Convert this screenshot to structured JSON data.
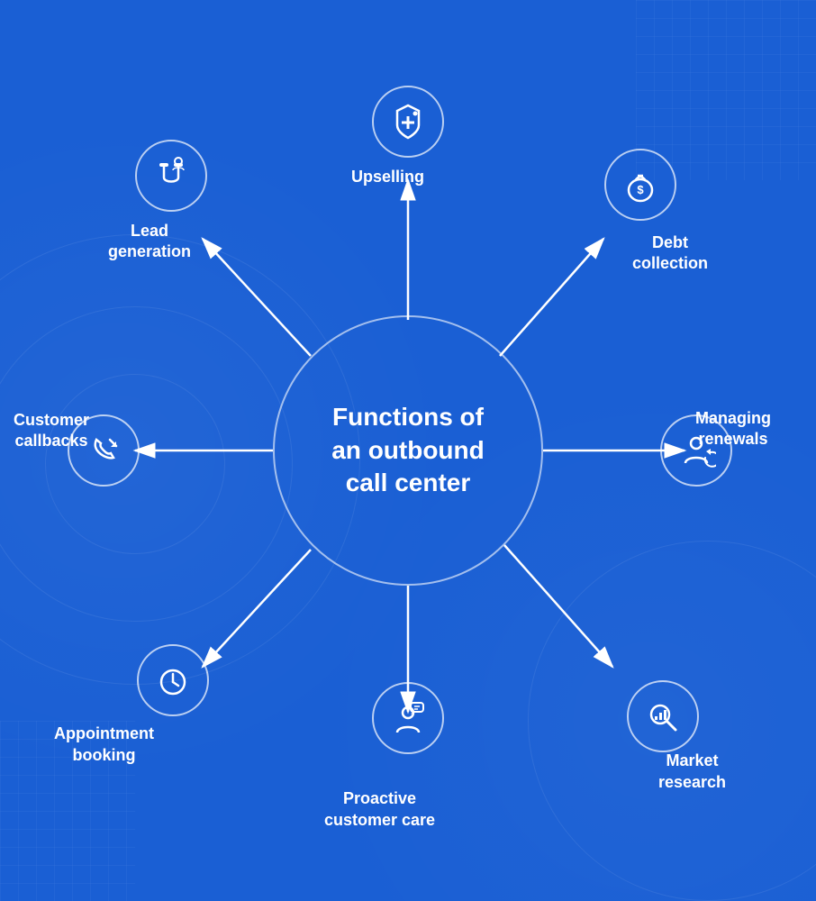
{
  "title": "Functions of an outbound call center",
  "center": {
    "line1": "Functions of",
    "line2": "an outbound",
    "line3": "call center"
  },
  "items": [
    {
      "id": "upselling",
      "label": "Upselling",
      "position": "top",
      "icon": "upselling"
    },
    {
      "id": "debt-collection",
      "label": "Debt\ncollection",
      "position": "top-right",
      "icon": "debt"
    },
    {
      "id": "managing-renewals",
      "label": "Managing\nrenewals",
      "position": "right",
      "icon": "renewals"
    },
    {
      "id": "market-research",
      "label": "Market\nresearch",
      "position": "bottom-right",
      "icon": "research"
    },
    {
      "id": "proactive-customer-care",
      "label": "Proactive\ncustomer care",
      "position": "bottom",
      "icon": "proactive"
    },
    {
      "id": "appointment-booking",
      "label": "Appointment\nbooking",
      "position": "bottom-left",
      "icon": "appointment"
    },
    {
      "id": "customer-callbacks",
      "label": "Customer\ncallbacks",
      "position": "left",
      "icon": "callbacks"
    },
    {
      "id": "lead-generation",
      "label": "Lead\ngeneration",
      "position": "top-left",
      "icon": "lead"
    }
  ],
  "colors": {
    "background": "#1a5fd4",
    "accent": "#2563eb",
    "white": "#ffffff"
  }
}
